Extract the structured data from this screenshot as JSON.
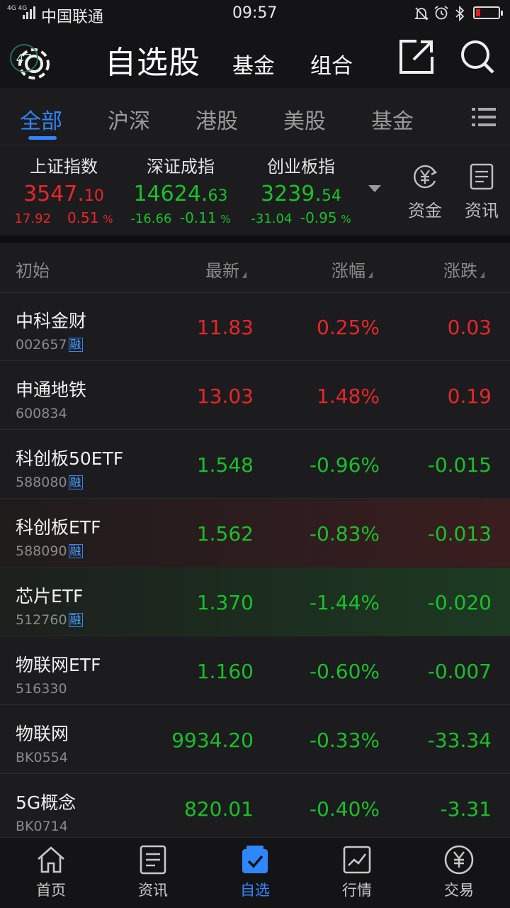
{
  "status_bar": {
    "network": "4G 4G",
    "carrier": "中国联通",
    "time": "09:57",
    "battery_color": "#e21d1d"
  },
  "header": {
    "badge": "47",
    "title": "自选股",
    "tab_fund": "基金",
    "tab_portfolio": "组合"
  },
  "categories": {
    "items": [
      "全部",
      "沪深",
      "港股",
      "美股",
      "基金"
    ],
    "active_color": "#2f87ff"
  },
  "indexes": [
    {
      "name": "上证指数",
      "value_int": "3547.",
      "value_dec": "10",
      "change": "17.92",
      "pct": "0.51",
      "pct_unit": "%",
      "trend": "up"
    },
    {
      "name": "深证成指",
      "value_int": "14624.",
      "value_dec": "63",
      "change": "-16.66",
      "pct": "-0.11",
      "pct_unit": "%",
      "trend": "down"
    },
    {
      "name": "创业板指",
      "value_int": "3239.",
      "value_dec": "54",
      "change": "-31.04",
      "pct": "-0.95",
      "pct_unit": "%",
      "trend": "down"
    }
  ],
  "side_buttons": {
    "funds": "资金",
    "news": "资讯"
  },
  "list_header": {
    "initial": "初始",
    "latest": "最新",
    "change_pct": "涨幅",
    "change": "涨跌"
  },
  "stocks": [
    {
      "name": "中科金财",
      "code": "002657",
      "margin": "融",
      "price": "11.83",
      "pct": "0.25%",
      "change": "0.03",
      "trend": "up"
    },
    {
      "name": "申通地铁",
      "code": "600834",
      "margin": "",
      "price": "13.03",
      "pct": "1.48%",
      "change": "0.19",
      "trend": "up"
    },
    {
      "name": "科创板50ETF",
      "code": "588080",
      "margin": "融",
      "price": "1.548",
      "pct": "-0.96%",
      "change": "-0.015",
      "trend": "down"
    },
    {
      "name": "科创板ETF",
      "code": "588090",
      "margin": "融",
      "price": "1.562",
      "pct": "-0.83%",
      "change": "-0.013",
      "trend": "down"
    },
    {
      "name": "芯片ETF",
      "code": "512760",
      "margin": "融",
      "price": "1.370",
      "pct": "-1.44%",
      "change": "-0.020",
      "trend": "down"
    },
    {
      "name": "物联网ETF",
      "code": "516330",
      "margin": "",
      "price": "1.160",
      "pct": "-0.60%",
      "change": "-0.007",
      "trend": "down"
    },
    {
      "name": "物联网",
      "code": "BK0554",
      "margin": "",
      "price": "9934.20",
      "pct": "-0.33%",
      "change": "-33.34",
      "trend": "down"
    },
    {
      "name": "5G概念",
      "code": "BK0714",
      "margin": "",
      "price": "820.01",
      "pct": "-0.40%",
      "change": "-3.31",
      "trend": "down"
    }
  ],
  "bottom_nav": {
    "items": [
      {
        "label": "首页",
        "icon": "home-icon"
      },
      {
        "label": "资讯",
        "icon": "news-icon"
      },
      {
        "label": "自选",
        "icon": "watchlist-icon"
      },
      {
        "label": "行情",
        "icon": "market-chart-icon"
      },
      {
        "label": "交易",
        "icon": "trade-yen-icon"
      }
    ],
    "active_index": 2
  },
  "colors": {
    "up": "#e8262b",
    "down": "#19c02b",
    "accent": "#2f87ff",
    "background": "#1c1c1e"
  }
}
